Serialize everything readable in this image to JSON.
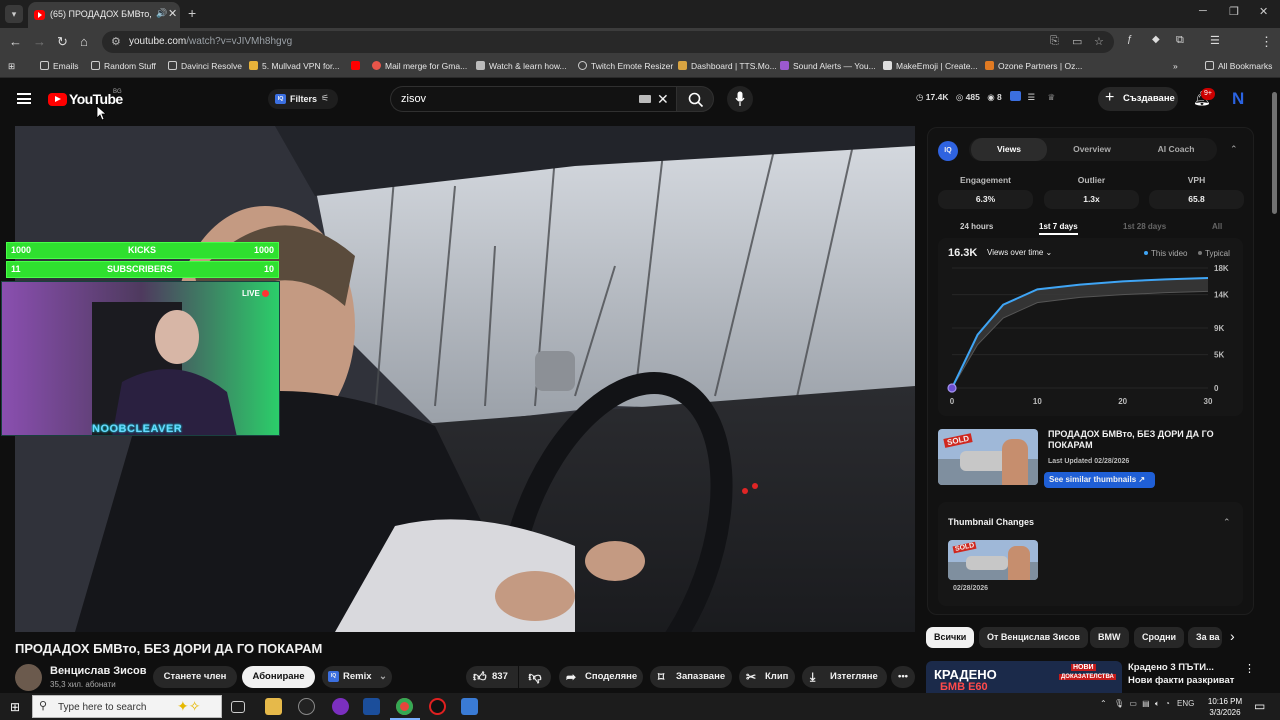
{
  "browser": {
    "tab_title": "(65) ПРОДАДОХ БМВто, БЕ",
    "url_host": "youtube.com",
    "url_path": "/watch?v=vJIVMh8hgvg",
    "bookmarks": [
      "Emails",
      "Random Stuff",
      "Davinci Resolve",
      "5. Mullvad VPN for...",
      "",
      "Mail merge for Gma...",
      "Watch & learn how...",
      "Twitch Emote Resizer",
      "Dashboard | TTS.Mo...",
      "Sound Alerts — You...",
      "MakeEmoji | Create...",
      "Ozone Partners | Oz..."
    ],
    "all_bookmarks": "All Bookmarks"
  },
  "yt": {
    "logo_text": "YouTube",
    "country": "BG",
    "filters_label": "Filters",
    "search_value": "zisov",
    "stats": {
      "views": "17.4K",
      "likes": "485",
      "count": "8"
    },
    "create_label": "Създаване",
    "notif_badge": "9+"
  },
  "overlay": {
    "kicks": {
      "left": "1000",
      "label": "KICKS",
      "right": "1000",
      "progress": 1.0
    },
    "subs": {
      "left": "11",
      "label": "SUBSCRIBERS",
      "right": "10",
      "progress": 1.0
    },
    "live_label": "LIVE",
    "streamer_name": "NOOBCLEAVER"
  },
  "video": {
    "title": "ПРОДАДОХ БМВто, БЕЗ ДОРИ ДА ГО ПОКАРАМ",
    "channel_name": "Венцислав Зисов",
    "channel_subs": "35,3 хил. абонати",
    "join_label": "Станете член",
    "subscribe_label": "Абониране",
    "remix_label": "Remix",
    "likes": "837",
    "share_label": "Споделяне",
    "save_label": "Запазване",
    "clip_label": "Клип",
    "download_label": "Изтегляне"
  },
  "iq_panel": {
    "logo": "IQ",
    "tabs": [
      "Views",
      "Overview",
      "AI Coach"
    ],
    "metrics": [
      {
        "label": "Engagement",
        "value": "6.3%"
      },
      {
        "label": "Outlier",
        "value": "1.3x"
      },
      {
        "label": "VPH",
        "value": "65.8"
      }
    ],
    "ranges": [
      "24 hours",
      "1st 7 days",
      "1st 28 days",
      "All"
    ],
    "chart_total": "16.3K",
    "chart_dropdown": "Views over time",
    "legend_this": "This video",
    "legend_typical": "Typical",
    "thumb_title": "ПРОДАДОХ БМВто, БЕЗ ДОРИ ДА ГО ПОКАРАМ",
    "thumb_updated": "Last Updated 02/28/2026",
    "thumb_btn": "See similar thumbnails",
    "changes_title": "Thumbnail Changes",
    "changes_date": "02/28/2026",
    "sold_label": "SOLD"
  },
  "chart_data": {
    "type": "area",
    "title": "16.3K",
    "x": [
      0,
      3,
      6,
      10,
      15,
      20,
      25,
      30
    ],
    "series": [
      {
        "name": "This video",
        "values": [
          0,
          8000,
          12500,
          14800,
          15500,
          16000,
          16300,
          16500
        ]
      },
      {
        "name": "Typical",
        "values": [
          0,
          6500,
          10500,
          12800,
          13600,
          14000,
          14300,
          14500
        ]
      }
    ],
    "xticks": [
      "0",
      "10",
      "20",
      "30"
    ],
    "yticks": [
      "0",
      "5K",
      "9K",
      "14K",
      "18K"
    ],
    "ylim": [
      0,
      18000
    ],
    "xlim": [
      0,
      30
    ]
  },
  "chips": [
    "Всички",
    "От Венцислав Зисов",
    "BMW",
    "Сродни",
    "За ва"
  ],
  "next_video": {
    "title": "Крадено 3 ПЪТИ... Нови факти разкриват ...",
    "thumb_text1": "НОВИ",
    "thumb_text2": "ДОКАЗАТЕЛСТВА",
    "thumb_text3": "КРАДЕНО",
    "thumb_text4": "БМВ Е60"
  },
  "taskbar": {
    "search_placeholder": "Type here to search",
    "lang": "ENG",
    "time": "10:16 PM",
    "date": "3/3/2026"
  }
}
